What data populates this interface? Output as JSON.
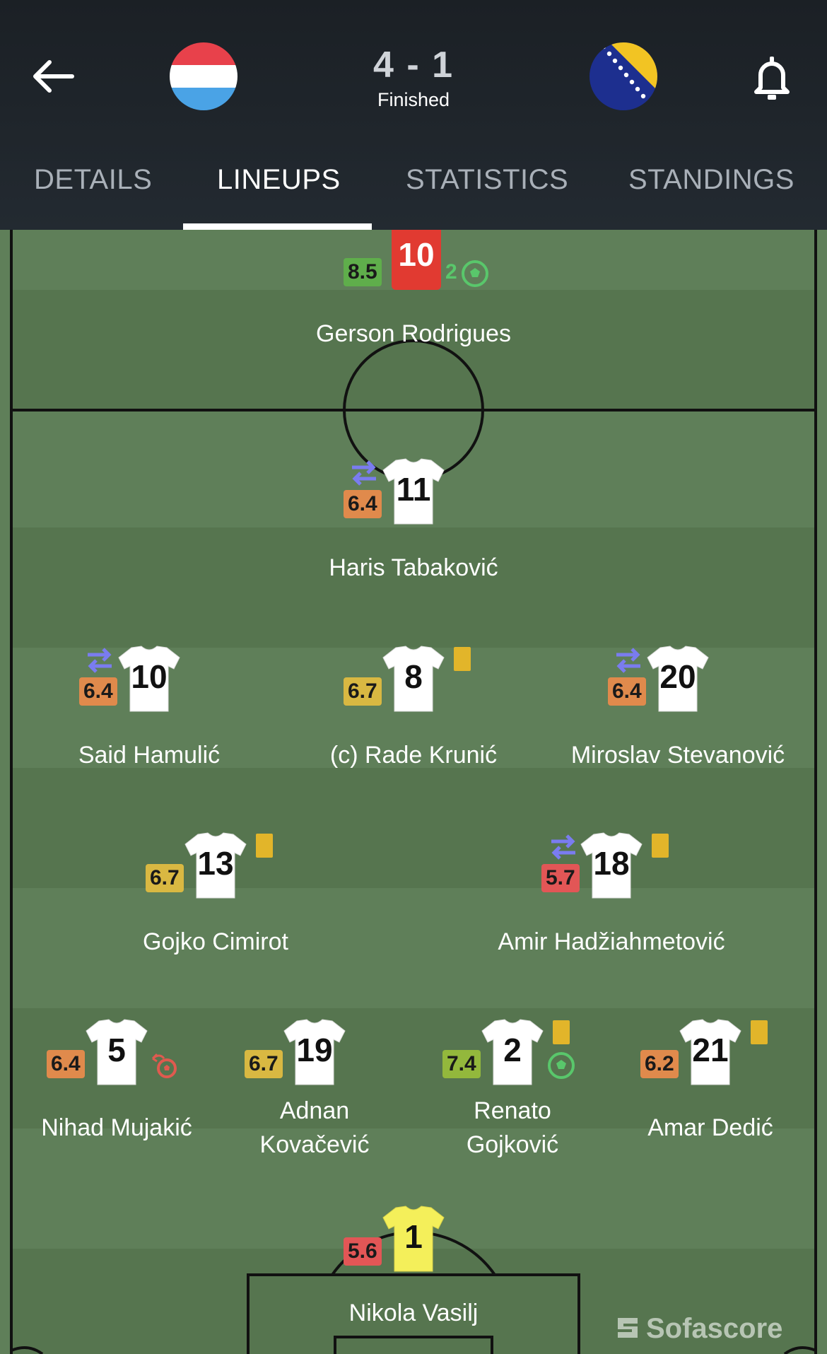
{
  "header": {
    "score": "4 - 1",
    "status": "Finished",
    "home_team_flag": "luxembourg-flag",
    "away_team_flag": "bosnia-herzegovina-flag"
  },
  "tabs": [
    {
      "label": "DETAILS"
    },
    {
      "label": "LINEUPS"
    },
    {
      "label": "STATISTICS"
    },
    {
      "label": "STANDINGS"
    }
  ],
  "opponent_top": {
    "name": "Gerson Rodrigues",
    "number": "10",
    "rating": "8.5",
    "goals": "2"
  },
  "players": [
    {
      "name": "Haris Tabaković",
      "number": "11",
      "rating": "6.4"
    },
    {
      "name": "Said Hamulić",
      "number": "10",
      "rating": "6.4"
    },
    {
      "name": "(c) Rade Krunić",
      "number": "8",
      "rating": "6.7"
    },
    {
      "name": "Miroslav Stevanović",
      "number": "20",
      "rating": "6.4"
    },
    {
      "name": "Gojko Cimirot",
      "number": "13",
      "rating": "6.7"
    },
    {
      "name": "Amir Hadžiahmetović",
      "number": "18",
      "rating": "5.7"
    },
    {
      "name": "Nihad Mujakić",
      "number": "5",
      "rating": "6.4"
    },
    {
      "name_line1": "Adnan",
      "name_line2": "Kovačević",
      "number": "19",
      "rating": "6.7"
    },
    {
      "name_line1": "Renato",
      "name_line2": "Gojković",
      "number": "2",
      "rating": "7.4"
    },
    {
      "name": "Amar Dedić",
      "number": "21",
      "rating": "6.2"
    },
    {
      "name": "Nikola Vasilj",
      "number": "1",
      "rating": "5.6"
    }
  ],
  "colors": {
    "rating_green": "#5fae4b",
    "rating_orange": "#e08a4c",
    "rating_yellow": "#d9b842",
    "rating_red": "#e25656",
    "rating_lime": "#93b83c",
    "yellow_card": "#e2b52a",
    "sub_icon": "#7a7cf0",
    "own_goal": "#e05a4f"
  },
  "watermark": "Sofascore"
}
